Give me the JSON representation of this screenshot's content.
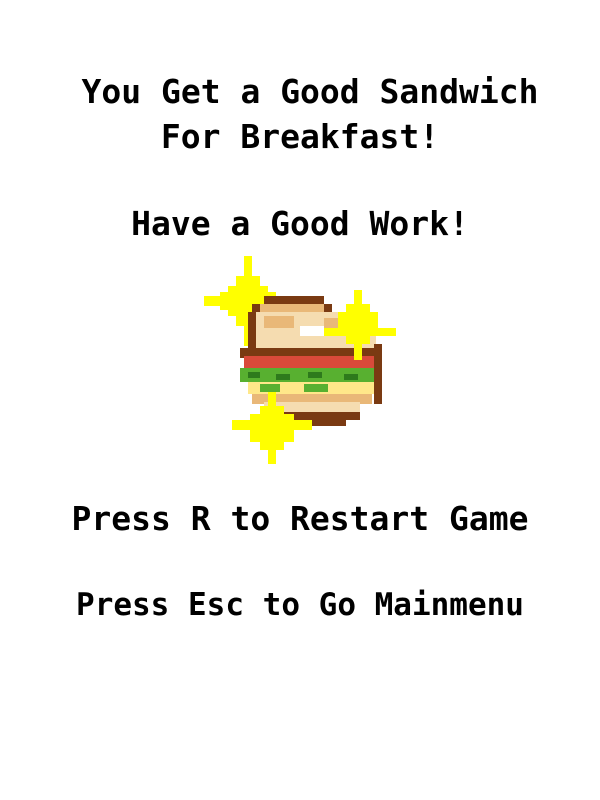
{
  "screen": {
    "title_line_1": "You Get a Good Sandwich",
    "title_line_2": "For Breakfast!",
    "subtitle": "Have a Good Work!",
    "restart_hint": "Press R to Restart Game",
    "mainmenu_hint": "Press Esc to Go Mainmenu"
  },
  "sprite": {
    "name": "sandwich-icon",
    "sparkle_name": "sparkle-icon"
  },
  "colors": {
    "background": "#ffffff",
    "text": "#000000",
    "sparkle": "#ffff00",
    "bread": "#f5dcb0",
    "bread_shade": "#e9b878",
    "crust": "#7a3a12",
    "tomato": "#d94a3a",
    "lettuce": "#58b030",
    "lettuce_dark": "#2e7a1c",
    "egg": "#ffe88a"
  }
}
